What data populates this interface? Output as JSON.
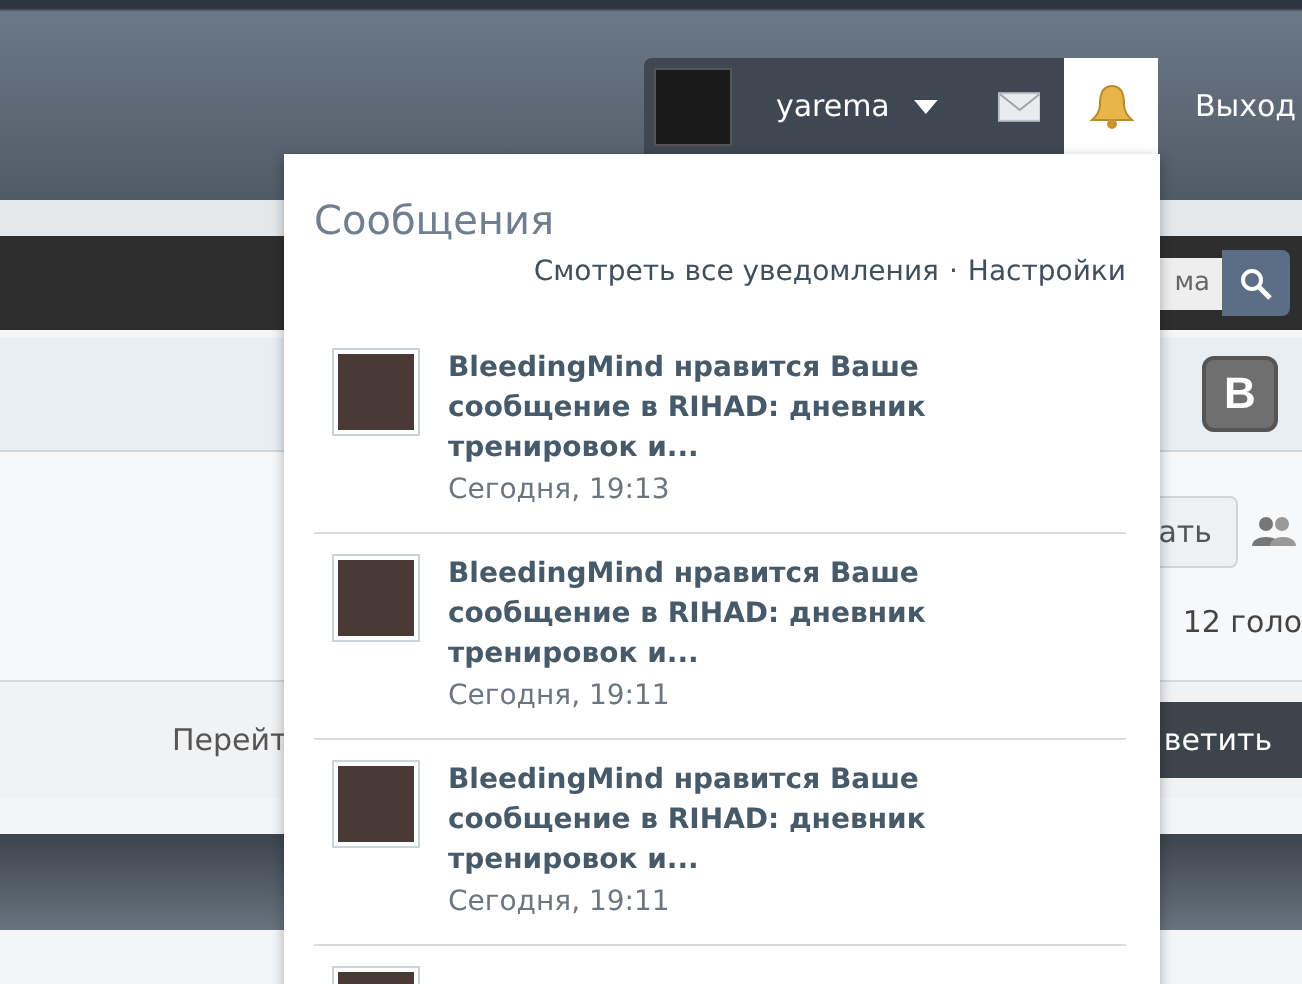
{
  "nav": {
    "username": "yarema",
    "logout": "Выход",
    "notifications_open": true
  },
  "search": {
    "value": "ма"
  },
  "share": {
    "label": "B"
  },
  "thread": {
    "button": "ать",
    "votes": "12 голо"
  },
  "reply_bar": {
    "jump": "Перейт",
    "reply_button": "ветить"
  },
  "popup": {
    "title": "Сообщения",
    "links": [
      "Смотреть все уведомления",
      "Настройки"
    ],
    "separator": "·",
    "notifications": [
      {
        "text": "BleedingMind нравится Ваше сообщение в RIHAD: дневник тренировок и...",
        "time": "Сегодня, 19:13"
      },
      {
        "text": "BleedingMind нравится Ваше сообщение в RIHAD: дневник тренировок и...",
        "time": "Сегодня, 19:11"
      },
      {
        "text": "BleedingMind нравится Ваше сообщение в RIHAD: дневник тренировок и...",
        "time": "Сегодня, 19:11"
      }
    ]
  }
}
